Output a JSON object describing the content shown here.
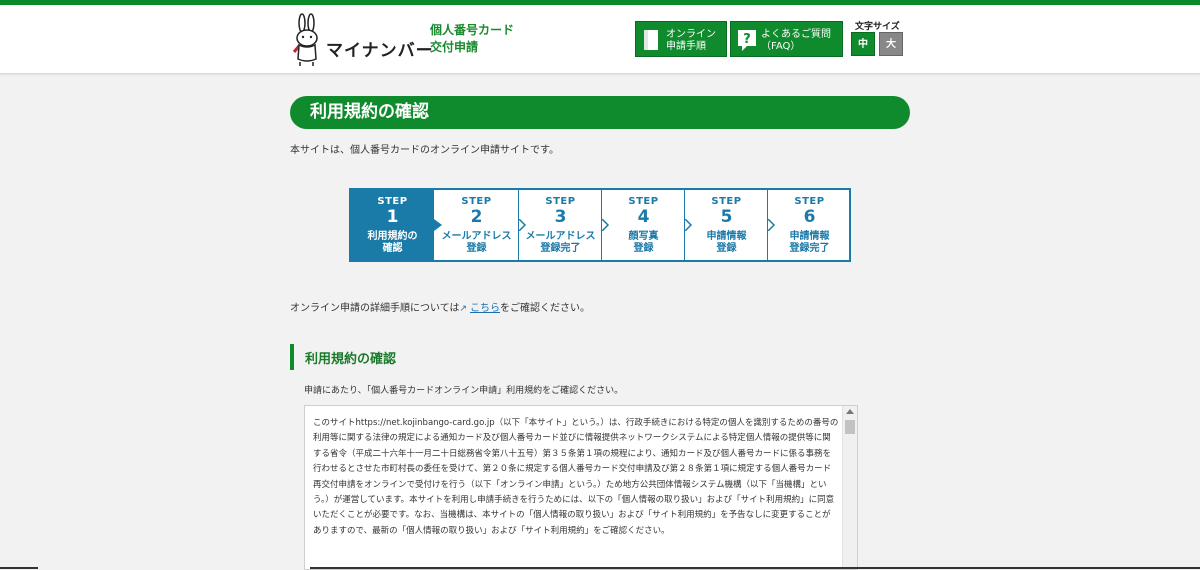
{
  "header": {
    "brand": "マイナンバー",
    "brand_sub": "個人番号カード\n交付申請",
    "buttons": [
      {
        "label": "オンライン\n申請手順",
        "icon": "book-icon"
      },
      {
        "label": "よくあるご質問\n（FAQ）",
        "icon": "question-icon"
      }
    ],
    "font_size": {
      "label": "文字サイズ",
      "options": [
        "中",
        "大"
      ],
      "selected": "中"
    }
  },
  "page": {
    "title": "利用規約の確認",
    "intro": "本サイトは、個人番号カードのオンライン申請サイトです。"
  },
  "steps": [
    {
      "label": "STEP",
      "num": "1",
      "text": "利用規約の\n確認",
      "active": true
    },
    {
      "label": "STEP",
      "num": "2",
      "text": "メールアドレス\n登録",
      "active": false
    },
    {
      "label": "STEP",
      "num": "3",
      "text": "メールアドレス\n登録完了",
      "active": false
    },
    {
      "label": "STEP",
      "num": "4",
      "text": "顔写真\n登録",
      "active": false
    },
    {
      "label": "STEP",
      "num": "5",
      "text": "申請情報\n登録",
      "active": false
    },
    {
      "label": "STEP",
      "num": "6",
      "text": "申請情報\n登録完了",
      "active": false
    }
  ],
  "procedure": {
    "before": "オンライン申請の詳細手順については",
    "link": "こちら",
    "after": "をご確認ください。"
  },
  "section": {
    "title": "利用規約の確認",
    "desc": "申請にあたり、「個人番号カードオンライン申請」利用規約をご確認ください。",
    "terms": "このサイトhttps://net.kojinbango-card.go.jp（以下「本サイト」という。）は、行政手続きにおける特定の個人を識別するための番号の利用等に関する法律の規定による通知カード及び個人番号カード並びに情報提供ネットワークシステムによる特定個人情報の提供等に関する省令（平成二十六年十一月二十日総務省令第八十五号）第３５条第１項の規程により、通知カード及び個人番号カードに係る事務を行わせるとさせた市町村長の委任を受けて、第２０条に規定する個人番号カード交付申請及び第２８条第１項に規定する個人番号カード再交付申請をオンラインで受付けを行う（以下「オンライン申請」という。）ため地方公共団体情報システム機構（以下「当機構」という。）が運営しています。本サイトを利用し申請手続きを行うためには、以下の「個人情報の取り扱い」および「サイト利用規約」に同意いただくことが必要です。なお、当機構は、本サイトの「個人情報の取り扱い」および「サイト利用規約」を予告なしに変更することがありますので、最新の「個人情報の取り扱い」および「サイト利用規約」をご確認ください。"
  },
  "colors": {
    "green": "#0f8a2c",
    "blue": "#1a7aa8",
    "link": "#1a6fb0"
  }
}
